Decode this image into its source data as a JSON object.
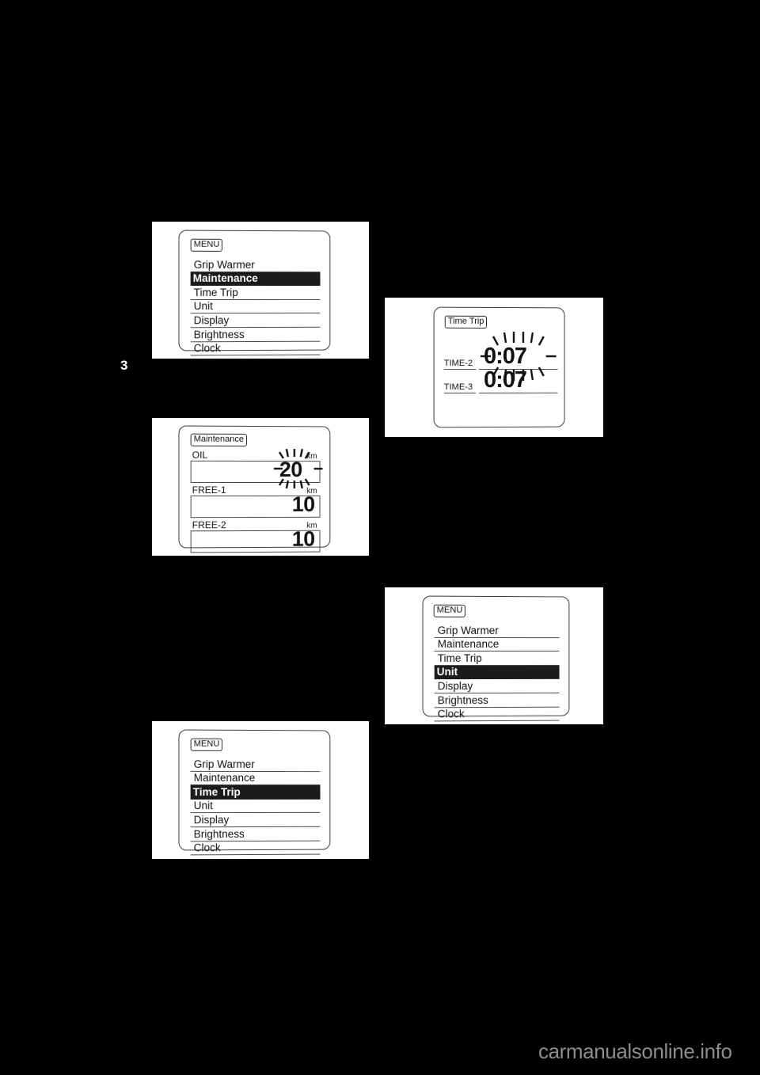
{
  "page": {
    "chapter_number": "3",
    "watermark": "carmanualsonline.info",
    "background_color": "#000000",
    "panel_color": "#ffffff"
  },
  "figures": {
    "menu_maintenance": {
      "title": "MENU",
      "items": [
        {
          "label": "Grip Warmer",
          "selected": false
        },
        {
          "label": "Maintenance",
          "selected": true
        },
        {
          "label": "Time Trip",
          "selected": false
        },
        {
          "label": "Unit",
          "selected": false
        },
        {
          "label": "Display",
          "selected": false
        },
        {
          "label": "Brightness",
          "selected": false
        },
        {
          "label": "Clock",
          "selected": false
        }
      ]
    },
    "maintenance": {
      "title": "Maintenance",
      "rows": [
        {
          "label": "OIL",
          "unit": "km",
          "value": "20",
          "flashing": true
        },
        {
          "label": "FREE-1",
          "unit": "km",
          "value": "10",
          "flashing": false
        },
        {
          "label": "FREE-2",
          "unit": "km",
          "value": "10",
          "flashing": false
        }
      ]
    },
    "time_trip": {
      "title": "Time Trip",
      "rows": [
        {
          "label": "TIME-2",
          "value": "0:07",
          "flashing": true
        },
        {
          "label": "TIME-3",
          "value": "0:07",
          "flashing": false
        }
      ]
    },
    "menu_time_trip": {
      "title": "MENU",
      "items": [
        {
          "label": "Grip Warmer",
          "selected": false
        },
        {
          "label": "Maintenance",
          "selected": false
        },
        {
          "label": "Time Trip",
          "selected": true
        },
        {
          "label": "Unit",
          "selected": false
        },
        {
          "label": "Display",
          "selected": false
        },
        {
          "label": "Brightness",
          "selected": false
        },
        {
          "label": "Clock",
          "selected": false
        }
      ]
    },
    "menu_unit": {
      "title": "MENU",
      "items": [
        {
          "label": "Grip Warmer",
          "selected": false
        },
        {
          "label": "Maintenance",
          "selected": false
        },
        {
          "label": "Time Trip",
          "selected": false
        },
        {
          "label": "Unit",
          "selected": true
        },
        {
          "label": "Display",
          "selected": false
        },
        {
          "label": "Brightness",
          "selected": false
        },
        {
          "label": "Clock",
          "selected": false
        }
      ]
    }
  }
}
